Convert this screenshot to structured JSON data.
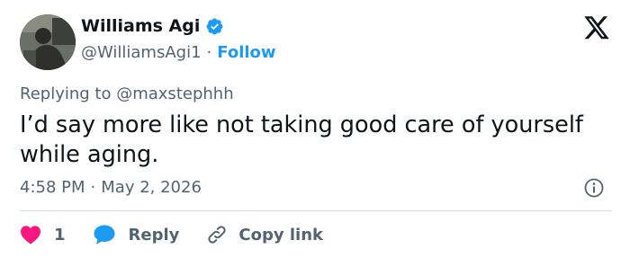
{
  "tweet": {
    "author_name": "Williams Agi",
    "author_handle": "@WilliamsAgi1",
    "separator": "·",
    "follow_label": "Follow",
    "replying_to_prefix": "Replying to",
    "replying_to_handle": "@maxstephhh",
    "text": "I’d say more like not taking good care of yourself while aging.",
    "time": "4:58 PM",
    "date": "May 2, 2026"
  },
  "actions": {
    "like_count": "1",
    "reply_label": "Reply",
    "copy_link_label": "Copy link"
  },
  "icons": {
    "verified": "verified-badge-icon",
    "logo": "x-logo-icon",
    "info": "info-icon",
    "like": "heart-icon",
    "reply": "speech-bubble-icon",
    "copy": "link-icon"
  },
  "colors": {
    "accent": "#1d9bf0",
    "like": "#f91880",
    "text": "#0f1419",
    "muted": "#536471",
    "divider": "#cfd9de"
  }
}
